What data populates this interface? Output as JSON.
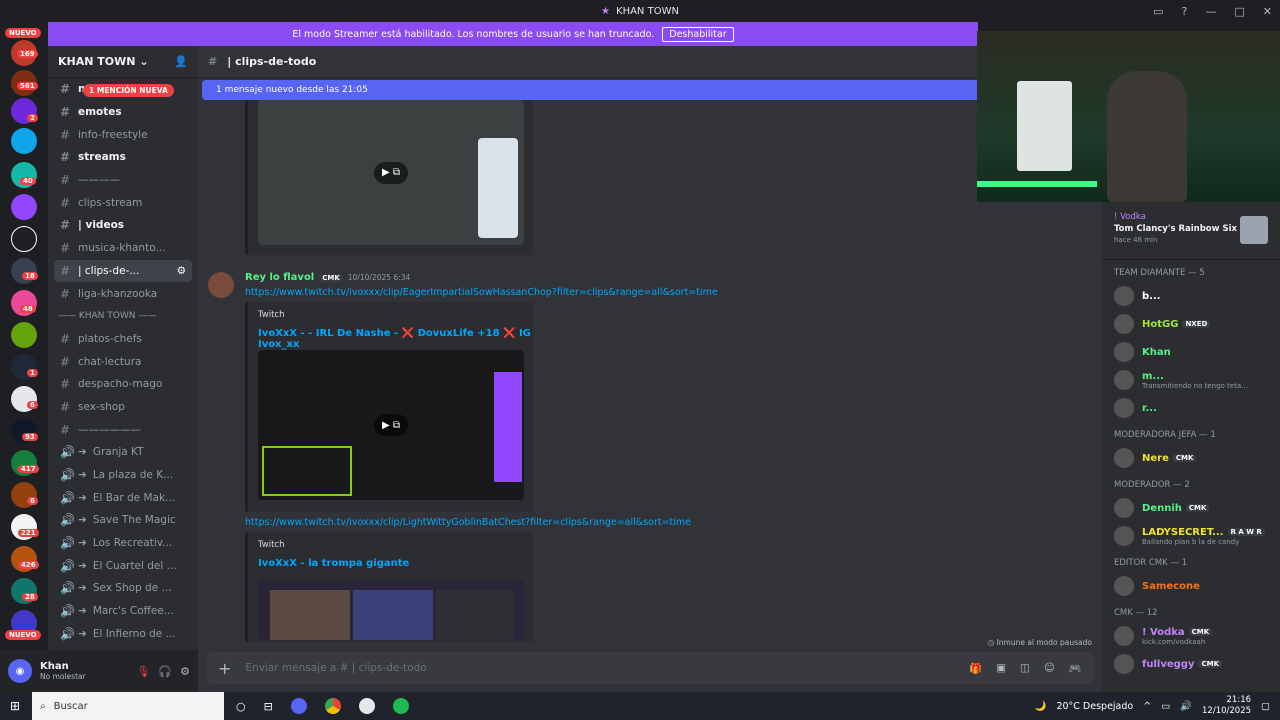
{
  "window": {
    "title": "KHAN TOWN"
  },
  "banner": {
    "text": "El modo Streamer está habilitado. Los nombres de usuario se han truncado.",
    "button": "Deshabilitar"
  },
  "guilds": {
    "new_label": "NUEVO",
    "badges": [
      "169",
      "561",
      "2",
      "40",
      "18",
      "48",
      "1",
      "6",
      "93",
      "417",
      "6",
      "221",
      "426",
      "28"
    ],
    "new_bottom": "NUEVO"
  },
  "server": {
    "name": "KHAN TOWN",
    "mention": "1 MENCIÓN NUEVA"
  },
  "channels": [
    {
      "name": "musica",
      "type": "text",
      "bold": true
    },
    {
      "name": "emotes",
      "type": "text",
      "bold": true
    },
    {
      "name": "info-freestyle",
      "type": "text"
    },
    {
      "name": "streams",
      "type": "text",
      "bold": true
    },
    {
      "name": "————",
      "type": "text"
    },
    {
      "name": "clips-stream",
      "type": "text"
    },
    {
      "name": "| videos",
      "type": "text",
      "bold": true
    },
    {
      "name": "musica-khanto...",
      "type": "text"
    },
    {
      "name": "| clips-de-...",
      "type": "text",
      "selected": true
    },
    {
      "name": "liga-khanzooka",
      "type": "text"
    }
  ],
  "category": "—— KHAN TOWN ——",
  "channels2": [
    {
      "name": "platos-chefs"
    },
    {
      "name": "chat-lectura"
    },
    {
      "name": "despacho-mago"
    },
    {
      "name": "sex-shop"
    },
    {
      "name": "——————"
    },
    {
      "name": "Granja KT",
      "voice": true
    },
    {
      "name": "La plaza de K...",
      "voice": true
    },
    {
      "name": "El Bar de Mak...",
      "voice": true
    },
    {
      "name": "Save The Magic",
      "voice": true
    },
    {
      "name": "Los Recreativ...",
      "voice": true
    },
    {
      "name": "El Cuartel del ...",
      "voice": true
    },
    {
      "name": "Sex Shop de ...",
      "voice": true
    },
    {
      "name": "Marc's Coffee...",
      "voice": true
    },
    {
      "name": "El Infierno de ...",
      "voice": true
    }
  ],
  "user": {
    "name": "Khan",
    "status": "No molestar"
  },
  "chat": {
    "channel": "| clips-de-todo",
    "new_messages": "1 mensaje nuevo desde las 21:05",
    "author": "Rey lo flavol",
    "author_tag": "CMK",
    "timestamp": "10/10/2025 6:34",
    "link1": "https://www.twitch.tv/ivoxxx/clip/EagerImpartialSowHassanChop?filter=clips&range=all&sort=time",
    "embed1_provider": "Twitch",
    "embed1_title": "IvoXxX - - IRL De Nashe - ❌ DovuxLife +18 ❌ IG Ivox_xx",
    "link2": "https://www.twitch.tv/ivoxxx/clip/LightWittyGoblinBatChest?filter=clips&range=all&sort=time",
    "embed2_provider": "Twitch",
    "embed2_title": "IvoXxX - la trompa gigante",
    "input_placeholder": "Enviar mensaje a #   | clips-de-todo",
    "immune": "Inmune al modo pausado"
  },
  "activity": {
    "user": "! Vodka",
    "game": "Tom Clancy's Rainbow Six ...",
    "time": "hace 46 min"
  },
  "members": [
    {
      "category": "TEAM DIAMANTE — 5"
    },
    {
      "name": "b...",
      "color": "#ffffff"
    },
    {
      "name": "HotGG",
      "color": "#a3e635",
      "tag": "NXED"
    },
    {
      "name": "Khan",
      "color": "#57f287"
    },
    {
      "name": "m...",
      "color": "#57f287",
      "sub": "Transmitiendo no tengo teta..."
    },
    {
      "name": "r...",
      "color": "#57f287"
    },
    {
      "category": "MODERADORA JEFA — 1"
    },
    {
      "name": "Nere",
      "color": "#f0e130",
      "tag": "CMK"
    },
    {
      "category": "MODERADOR — 2"
    },
    {
      "name": "Dennih",
      "color": "#57f287",
      "tag": "CMK"
    },
    {
      "name": "LADYSECRET...",
      "color": "#f0e130",
      "tag": "R A W R",
      "sub": "Bailando plan b la de candy"
    },
    {
      "category": "EDITOR CMK — 1"
    },
    {
      "name": "Samecone",
      "color": "#f97316"
    },
    {
      "category": "CMK — 12"
    },
    {
      "name": "! Vodka",
      "color": "#c084fc",
      "tag": "CMK",
      "sub": "kick.com/vodkaah"
    },
    {
      "name": "fullveggy",
      "color": "#c084fc",
      "tag": "CMK"
    }
  ],
  "taskbar": {
    "search": "Buscar",
    "weather": "20°C  Despejado",
    "time": "21:16",
    "date": "12/10/2025"
  }
}
